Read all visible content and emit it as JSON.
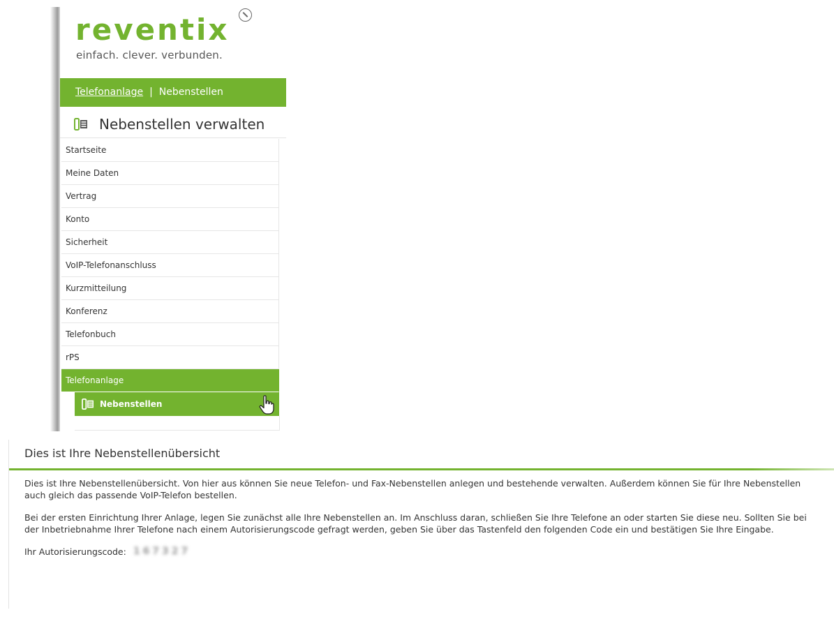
{
  "brand": {
    "name": "reventix",
    "tagline": "einfach. clever. verbunden.",
    "accent_color": "#73b32f"
  },
  "breadcrumb": {
    "parent": "Telefonanlage",
    "separator": "|",
    "current": "Nebenstellen"
  },
  "section": {
    "icon": "extensions-icon",
    "title": "Nebenstellen verwalten"
  },
  "menu": {
    "items": [
      {
        "label": "Startseite"
      },
      {
        "label": "Meine Daten"
      },
      {
        "label": "Vertrag"
      },
      {
        "label": "Konto"
      },
      {
        "label": "Sicherheit"
      },
      {
        "label": "VoIP-Telefonanschluss"
      },
      {
        "label": "Kurzmitteilung"
      },
      {
        "label": "Konferenz"
      },
      {
        "label": "Telefonbuch"
      },
      {
        "label": "rPS"
      },
      {
        "label": "Telefonanlage"
      }
    ],
    "active_index": 10,
    "submenu": {
      "label": "Nebenstellen",
      "icon": "extensions-icon",
      "cursor_icon": "hand-pointer-icon"
    }
  },
  "panel": {
    "title": "Dies ist Ihre Nebenstellenübersicht",
    "paragraph1": "Dies ist Ihre Nebenstellenübersicht. Von hier aus können Sie neue Telefon- und Fax-Nebenstellen anlegen und bestehende verwalten. Außerdem können Sie für Ihre Nebenstellen auch gleich das passende VoIP-Telefon bestellen.",
    "paragraph2": "Bei der ersten Einrichtung Ihrer Anlage, legen Sie zunächst alle Ihre Nebenstellen an. Im Anschluss daran, schließen Sie Ihre Telefone an oder starten Sie diese neu. Sollten Sie bei der Inbetriebnahme Ihrer Telefone nach einem Autorisierungscode gefragt werden, geben Sie über das Tastenfeld den folgenden Code ein und bestätigen Sie Ihre Eingabe.",
    "auth_label": "Ihr Autorisierungscode:",
    "auth_code": "167327"
  }
}
